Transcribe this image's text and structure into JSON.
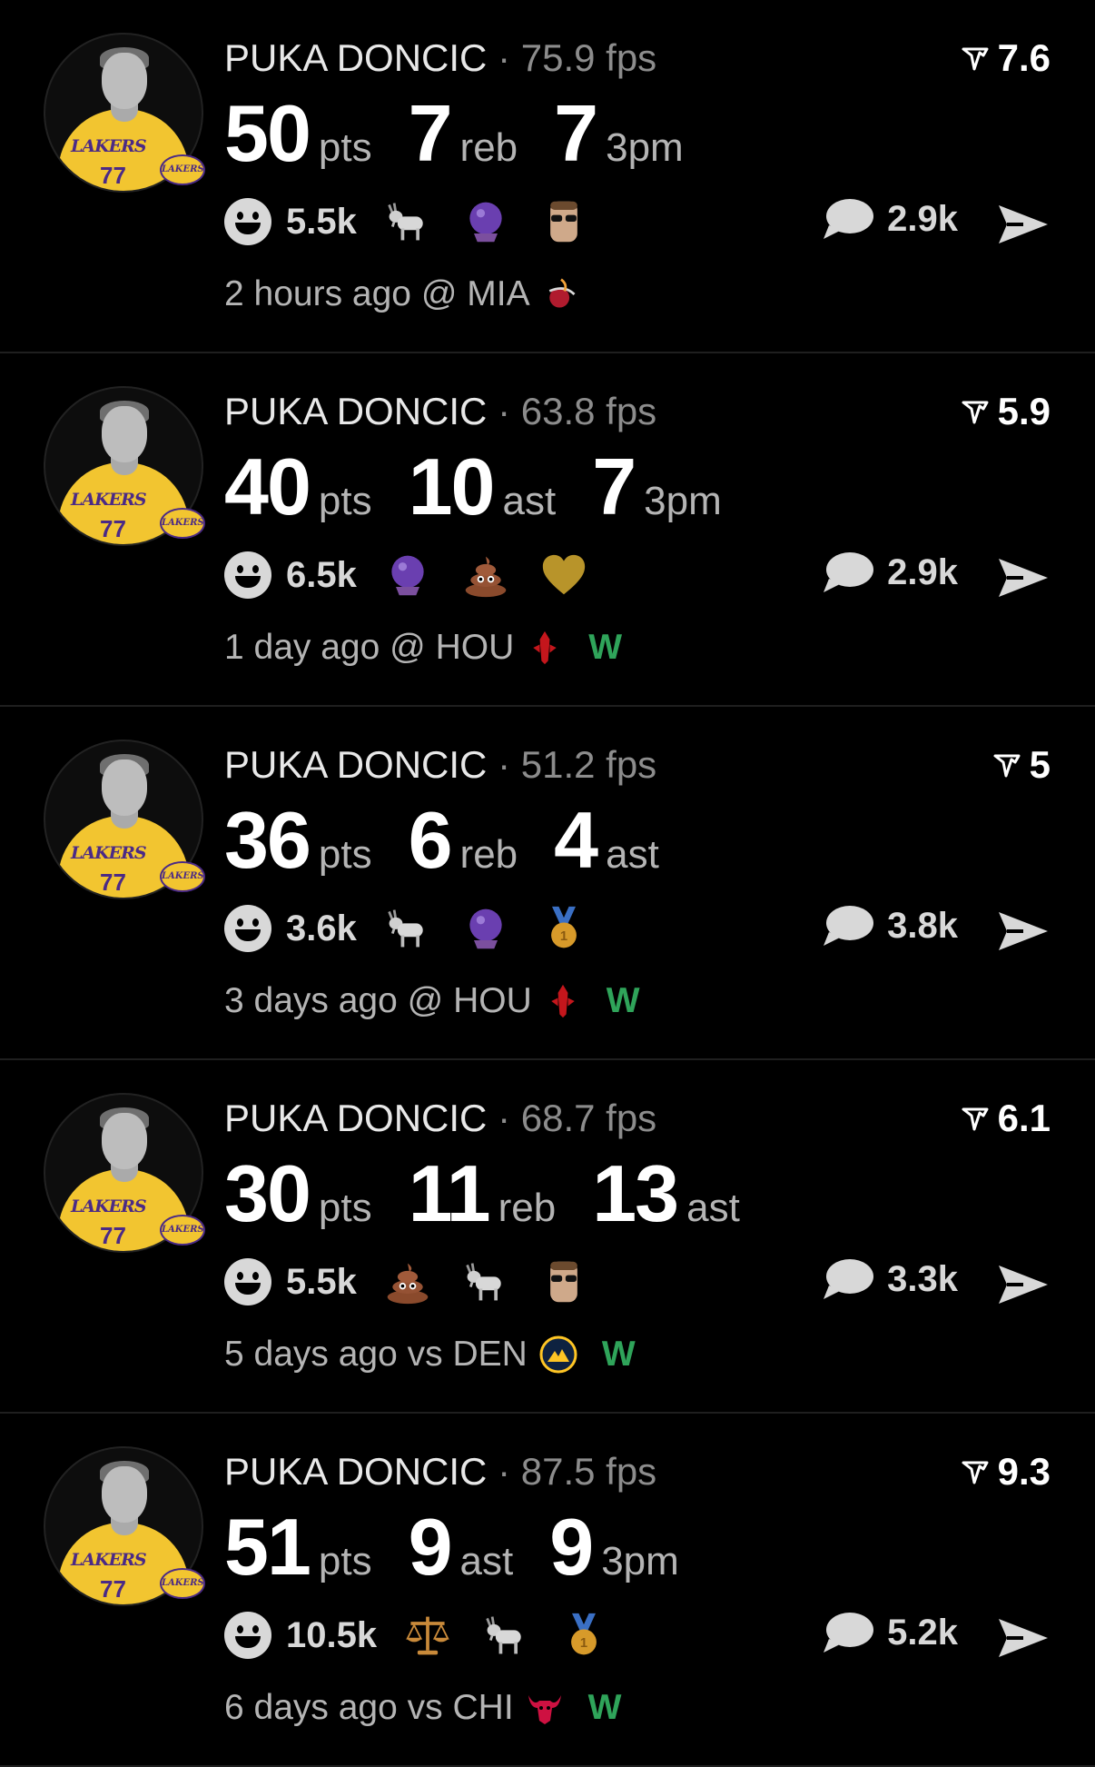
{
  "colors": {
    "win": "#2fa45a",
    "lakers_gold": "#f2c530",
    "lakers_purple": "#4b2a86"
  },
  "avatar": {
    "jersey_text": "LAKERS",
    "jersey_number": "77",
    "badge_text": "LAKERS"
  },
  "posts": [
    {
      "player": "PUKA DONCIC",
      "separator": "·",
      "fps": "75.9 fps",
      "rating": "7.6",
      "stats": [
        {
          "value": "50",
          "label": "pts"
        },
        {
          "value": "7",
          "label": "reb"
        },
        {
          "value": "7",
          "label": "3pm"
        }
      ],
      "reactions_count": "5.5k",
      "emojis": [
        "goat-icon",
        "crystal-ball-icon",
        "sunglasses-player-icon"
      ],
      "comments": "2.9k",
      "time": "2 hours ago",
      "venue": "@ MIA",
      "team_logo": "heat-logo-icon",
      "result": ""
    },
    {
      "player": "PUKA DONCIC",
      "separator": "·",
      "fps": "63.8 fps",
      "rating": "5.9",
      "stats": [
        {
          "value": "40",
          "label": "pts"
        },
        {
          "value": "10",
          "label": "ast"
        },
        {
          "value": "7",
          "label": "3pm"
        }
      ],
      "reactions_count": "6.5k",
      "emojis": [
        "crystal-ball-icon",
        "poop-icon",
        "gold-heart-icon"
      ],
      "comments": "2.9k",
      "time": "1 day ago",
      "venue": "@ HOU",
      "team_logo": "rockets-logo-icon",
      "result": "W"
    },
    {
      "player": "PUKA DONCIC",
      "separator": "·",
      "fps": "51.2 fps",
      "rating": "5",
      "stats": [
        {
          "value": "36",
          "label": "pts"
        },
        {
          "value": "6",
          "label": "reb"
        },
        {
          "value": "4",
          "label": "ast"
        }
      ],
      "reactions_count": "3.6k",
      "emojis": [
        "goat-icon",
        "crystal-ball-icon",
        "gold-medal-icon"
      ],
      "comments": "3.8k",
      "time": "3 days ago",
      "venue": "@ HOU",
      "team_logo": "rockets-logo-icon",
      "result": "W"
    },
    {
      "player": "PUKA DONCIC",
      "separator": "·",
      "fps": "68.7 fps",
      "rating": "6.1",
      "stats": [
        {
          "value": "30",
          "label": "pts"
        },
        {
          "value": "11",
          "label": "reb"
        },
        {
          "value": "13",
          "label": "ast"
        }
      ],
      "reactions_count": "5.5k",
      "emojis": [
        "poop-icon",
        "goat-icon",
        "sunglasses-player-icon"
      ],
      "comments": "3.3k",
      "time": "5 days ago",
      "venue": "vs DEN",
      "team_logo": "nuggets-logo-icon",
      "result": "W"
    },
    {
      "player": "PUKA DONCIC",
      "separator": "·",
      "fps": "87.5 fps",
      "rating": "9.3",
      "stats": [
        {
          "value": "51",
          "label": "pts"
        },
        {
          "value": "9",
          "label": "ast"
        },
        {
          "value": "9",
          "label": "3pm"
        }
      ],
      "reactions_count": "10.5k",
      "emojis": [
        "scales-icon",
        "goat-icon",
        "gold-medal-icon"
      ],
      "comments": "5.2k",
      "time": "6 days ago",
      "venue": "vs CHI",
      "team_logo": "bulls-logo-icon",
      "result": "W"
    }
  ]
}
